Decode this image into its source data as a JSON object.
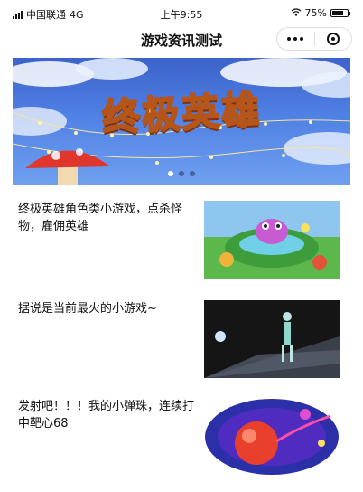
{
  "status_bar": {
    "carrier": "中国联通",
    "network": "4G",
    "time": "上午9:55",
    "battery": "75%",
    "battery_level": 0.75
  },
  "navbar": {
    "title": "游戏资讯测试"
  },
  "banner": {
    "title": "终极英雄",
    "slide_count": 3,
    "active_index": 0
  },
  "news": [
    {
      "text": "终极英雄角色类小游戏，点杀怪物，雇佣英雄"
    },
    {
      "text": "据说是当前最火的小游戏~"
    },
    {
      "text": "发射吧！！！我的小弹珠，连续打中靶心68"
    }
  ],
  "colors": {
    "banner_sky": "#4f80e4",
    "banner_title": "#ffd84a",
    "background": "#ffffff"
  }
}
